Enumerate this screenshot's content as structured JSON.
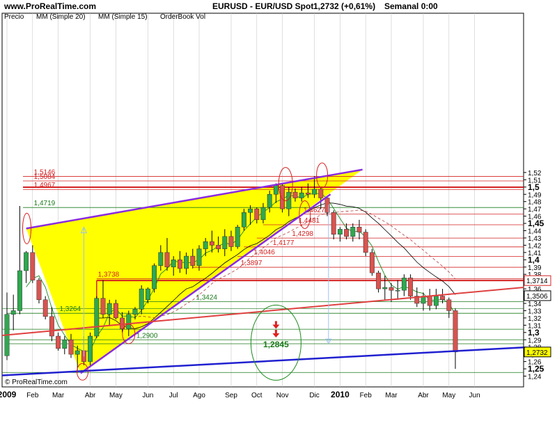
{
  "chart_data": {
    "type": "candlestick",
    "title": "EURUSD - EUR/USD Spot",
    "price_change": "1,2732 (+0,61%)",
    "timeframe": "Semanal 0:00",
    "watermark_top": "www.ProRealTime.com",
    "watermark_bottom": "© ProRealTime.com",
    "legend": [
      "Precio",
      "MM (Simple 20)",
      "MM (Simple 15)",
      "OrderBook Vol"
    ],
    "ylim": [
      1.23,
      1.53
    ],
    "y_ticks": [
      "1,52",
      "1,51",
      "1,5",
      "1,49",
      "1,48",
      "1,47",
      "1,46",
      "1,45",
      "1,44",
      "1,43",
      "1,42",
      "1,41",
      "1,4",
      "1,39",
      "1,38",
      "1,37",
      "1,36",
      "1,35",
      "1,34",
      "1,33",
      "1,32",
      "1,31",
      "1,3",
      "1,29",
      "1,28",
      "1,27",
      "1,26",
      "1,25",
      "1,24"
    ],
    "y_ticks_bold": [
      "1,5",
      "1,45",
      "1,4",
      "1,3",
      "1,25"
    ],
    "x_ticks": [
      {
        "label": "2009",
        "week": 0,
        "bold": true
      },
      {
        "label": "Feb",
        "week": 4
      },
      {
        "label": "Mar",
        "week": 8
      },
      {
        "label": "Abr",
        "week": 13
      },
      {
        "label": "May",
        "week": 17
      },
      {
        "label": "Jun",
        "week": 22
      },
      {
        "label": "Jul",
        "week": 26
      },
      {
        "label": "Ago",
        "week": 30
      },
      {
        "label": "Sep",
        "week": 35
      },
      {
        "label": "Oct",
        "week": 39
      },
      {
        "label": "Nov",
        "week": 43
      },
      {
        "label": "Dic",
        "week": 48
      },
      {
        "label": "2010",
        "week": 52,
        "bold": true
      },
      {
        "label": "Feb",
        "week": 56
      },
      {
        "label": "Mar",
        "week": 60
      },
      {
        "label": "Abr",
        "week": 65
      },
      {
        "label": "May",
        "week": 69
      },
      {
        "label": "Jun",
        "week": 73
      }
    ],
    "last_price_label": "1,2732",
    "right_labels": [
      {
        "value": 1.3714,
        "label": "1,3714",
        "style": "red"
      },
      {
        "value": 1.3506,
        "label": "1,3506",
        "style": "plain"
      },
      {
        "value": 1.2732,
        "label": "1,2732",
        "style": "yellow"
      }
    ],
    "horizontal_levels": [
      {
        "value": 1.5146,
        "label": "1,5146",
        "color": "red"
      },
      {
        "value": 1.5084,
        "label": "1,5084",
        "color": "red"
      },
      {
        "value": 1.4967,
        "label": "1,4967",
        "color": "red"
      },
      {
        "value": 1.4719,
        "label": "1,4719",
        "color": "green"
      },
      {
        "value": 1.4627,
        "label": "1,4627",
        "color": "red"
      },
      {
        "value": 1.4481,
        "label": "1,4481",
        "color": "red"
      },
      {
        "value": 1.4298,
        "label": "1,4298",
        "color": "red"
      },
      {
        "value": 1.4177,
        "label": "1,4177",
        "color": "red"
      },
      {
        "value": 1.4046,
        "label": "1,4046",
        "color": "red"
      },
      {
        "value": 1.3897,
        "label": "1,3897",
        "color": "red"
      },
      {
        "value": 1.3738,
        "label": "1,3738",
        "color": "red"
      },
      {
        "value": 1.3424,
        "label": "1,3424",
        "color": "green"
      },
      {
        "value": 1.3264,
        "label": "1,3264",
        "color": "green"
      },
      {
        "value": 1.29,
        "label": "1,2900",
        "color": "green"
      },
      {
        "value": 1.2845,
        "label": "1,2845",
        "color": "green"
      }
    ],
    "candles": [
      {
        "w": 0,
        "o": 1.268,
        "h": 1.355,
        "l": 1.262,
        "c": 1.325
      },
      {
        "w": 1,
        "o": 1.325,
        "h": 1.352,
        "l": 1.303,
        "c": 1.33
      },
      {
        "w": 2,
        "o": 1.33,
        "h": 1.474,
        "l": 1.325,
        "c": 1.385
      },
      {
        "w": 3,
        "o": 1.385,
        "h": 1.412,
        "l": 1.368,
        "c": 1.41
      },
      {
        "w": 4,
        "o": 1.41,
        "h": 1.42,
        "l": 1.368,
        "c": 1.372
      },
      {
        "w": 5,
        "o": 1.372,
        "h": 1.375,
        "l": 1.34,
        "c": 1.345
      },
      {
        "w": 6,
        "o": 1.345,
        "h": 1.35,
        "l": 1.318,
        "c": 1.322
      },
      {
        "w": 7,
        "o": 1.322,
        "h": 1.335,
        "l": 1.288,
        "c": 1.295
      },
      {
        "w": 8,
        "o": 1.295,
        "h": 1.3,
        "l": 1.275,
        "c": 1.278
      },
      {
        "w": 9,
        "o": 1.278,
        "h": 1.295,
        "l": 1.27,
        "c": 1.29
      },
      {
        "w": 10,
        "o": 1.29,
        "h": 1.298,
        "l": 1.265,
        "c": 1.27
      },
      {
        "w": 11,
        "o": 1.27,
        "h": 1.282,
        "l": 1.248,
        "c": 1.275
      },
      {
        "w": 12,
        "o": 1.275,
        "h": 1.295,
        "l": 1.255,
        "c": 1.26
      },
      {
        "w": 13,
        "o": 1.26,
        "h": 1.3,
        "l": 1.255,
        "c": 1.295
      },
      {
        "w": 14,
        "o": 1.295,
        "h": 1.35,
        "l": 1.292,
        "c": 1.347
      },
      {
        "w": 15,
        "o": 1.347,
        "h": 1.372,
        "l": 1.32,
        "c": 1.325
      },
      {
        "w": 16,
        "o": 1.325,
        "h": 1.345,
        "l": 1.31,
        "c": 1.34
      },
      {
        "w": 17,
        "o": 1.34,
        "h": 1.345,
        "l": 1.318,
        "c": 1.32
      },
      {
        "w": 18,
        "o": 1.32,
        "h": 1.328,
        "l": 1.3,
        "c": 1.305
      },
      {
        "w": 19,
        "o": 1.305,
        "h": 1.33,
        "l": 1.295,
        "c": 1.325
      },
      {
        "w": 20,
        "o": 1.325,
        "h": 1.335,
        "l": 1.318,
        "c": 1.332
      },
      {
        "w": 21,
        "o": 1.332,
        "h": 1.365,
        "l": 1.325,
        "c": 1.36
      },
      {
        "w": 22,
        "o": 1.345,
        "h": 1.362,
        "l": 1.34,
        "c": 1.36
      },
      {
        "w": 23,
        "o": 1.36,
        "h": 1.395,
        "l": 1.355,
        "c": 1.392
      },
      {
        "w": 24,
        "o": 1.392,
        "h": 1.42,
        "l": 1.385,
        "c": 1.41
      },
      {
        "w": 25,
        "o": 1.41,
        "h": 1.43,
        "l": 1.385,
        "c": 1.39
      },
      {
        "w": 26,
        "o": 1.39,
        "h": 1.405,
        "l": 1.378,
        "c": 1.4
      },
      {
        "w": 27,
        "o": 1.4,
        "h": 1.412,
        "l": 1.382,
        "c": 1.388
      },
      {
        "w": 28,
        "o": 1.388,
        "h": 1.41,
        "l": 1.38,
        "c": 1.405
      },
      {
        "w": 29,
        "o": 1.405,
        "h": 1.415,
        "l": 1.388,
        "c": 1.392
      },
      {
        "w": 30,
        "o": 1.392,
        "h": 1.42,
        "l": 1.385,
        "c": 1.415
      },
      {
        "w": 31,
        "o": 1.415,
        "h": 1.43,
        "l": 1.405,
        "c": 1.425
      },
      {
        "w": 32,
        "o": 1.425,
        "h": 1.44,
        "l": 1.41,
        "c": 1.42
      },
      {
        "w": 33,
        "o": 1.42,
        "h": 1.432,
        "l": 1.41,
        "c": 1.415
      },
      {
        "w": 34,
        "o": 1.415,
        "h": 1.442,
        "l": 1.405,
        "c": 1.432
      },
      {
        "w": 35,
        "o": 1.432,
        "h": 1.44,
        "l": 1.412,
        "c": 1.418
      },
      {
        "w": 36,
        "o": 1.418,
        "h": 1.448,
        "l": 1.415,
        "c": 1.445
      },
      {
        "w": 37,
        "o": 1.445,
        "h": 1.47,
        "l": 1.44,
        "c": 1.465
      },
      {
        "w": 38,
        "o": 1.465,
        "h": 1.475,
        "l": 1.448,
        "c": 1.47
      },
      {
        "w": 39,
        "o": 1.47,
        "h": 1.472,
        "l": 1.45,
        "c": 1.455
      },
      {
        "w": 40,
        "o": 1.455,
        "h": 1.478,
        "l": 1.45,
        "c": 1.472
      },
      {
        "w": 41,
        "o": 1.472,
        "h": 1.495,
        "l": 1.465,
        "c": 1.49
      },
      {
        "w": 42,
        "o": 1.49,
        "h": 1.505,
        "l": 1.478,
        "c": 1.502
      },
      {
        "w": 43,
        "o": 1.502,
        "h": 1.505,
        "l": 1.465,
        "c": 1.47
      },
      {
        "w": 44,
        "o": 1.47,
        "h": 1.5,
        "l": 1.46,
        "c": 1.493
      },
      {
        "w": 45,
        "o": 1.493,
        "h": 1.498,
        "l": 1.48,
        "c": 1.485
      },
      {
        "w": 46,
        "o": 1.485,
        "h": 1.5,
        "l": 1.48,
        "c": 1.492
      },
      {
        "w": 47,
        "o": 1.492,
        "h": 1.505,
        "l": 1.485,
        "c": 1.49
      },
      {
        "w": 48,
        "o": 1.49,
        "h": 1.515,
        "l": 1.485,
        "c": 1.497
      },
      {
        "w": 49,
        "o": 1.497,
        "h": 1.5,
        "l": 1.47,
        "c": 1.485
      },
      {
        "w": 50,
        "o": 1.485,
        "h": 1.488,
        "l": 1.46,
        "c": 1.465
      },
      {
        "w": 51,
        "o": 1.465,
        "h": 1.468,
        "l": 1.428,
        "c": 1.435
      },
      {
        "w": 52,
        "o": 1.435,
        "h": 1.445,
        "l": 1.425,
        "c": 1.442
      },
      {
        "w": 53,
        "o": 1.442,
        "h": 1.45,
        "l": 1.428,
        "c": 1.432
      },
      {
        "w": 54,
        "o": 1.432,
        "h": 1.45,
        "l": 1.425,
        "c": 1.445
      },
      {
        "w": 55,
        "o": 1.445,
        "h": 1.455,
        "l": 1.428,
        "c": 1.438
      },
      {
        "w": 56,
        "o": 1.438,
        "h": 1.442,
        "l": 1.405,
        "c": 1.41
      },
      {
        "w": 57,
        "o": 1.41,
        "h": 1.415,
        "l": 1.378,
        "c": 1.382
      },
      {
        "w": 58,
        "o": 1.382,
        "h": 1.385,
        "l": 1.355,
        "c": 1.36
      },
      {
        "w": 59,
        "o": 1.36,
        "h": 1.378,
        "l": 1.345,
        "c": 1.362
      },
      {
        "w": 60,
        "o": 1.362,
        "h": 1.368,
        "l": 1.342,
        "c": 1.358
      },
      {
        "w": 61,
        "o": 1.358,
        "h": 1.372,
        "l": 1.345,
        "c": 1.358
      },
      {
        "w": 62,
        "o": 1.358,
        "h": 1.38,
        "l": 1.35,
        "c": 1.375
      },
      {
        "w": 63,
        "o": 1.375,
        "h": 1.38,
        "l": 1.345,
        "c": 1.35
      },
      {
        "w": 64,
        "o": 1.35,
        "h": 1.362,
        "l": 1.335,
        "c": 1.34
      },
      {
        "w": 65,
        "o": 1.34,
        "h": 1.355,
        "l": 1.33,
        "c": 1.35
      },
      {
        "w": 66,
        "o": 1.35,
        "h": 1.36,
        "l": 1.33,
        "c": 1.337
      },
      {
        "w": 67,
        "o": 1.337,
        "h": 1.36,
        "l": 1.332,
        "c": 1.35
      },
      {
        "w": 68,
        "o": 1.35,
        "h": 1.36,
        "l": 1.34,
        "c": 1.345
      },
      {
        "w": 69,
        "o": 1.345,
        "h": 1.348,
        "l": 1.32,
        "c": 1.33
      },
      {
        "w": 70,
        "o": 1.33,
        "h": 1.333,
        "l": 1.25,
        "c": 1.2732
      }
    ]
  }
}
